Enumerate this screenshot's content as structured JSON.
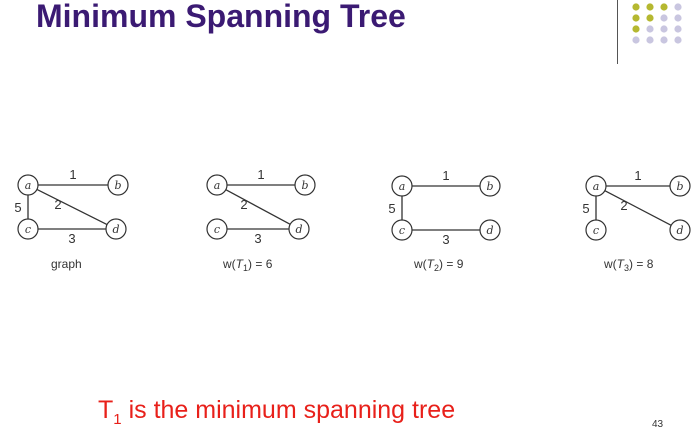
{
  "slide": {
    "title": "Minimum Spanning Tree",
    "caption_prefix": "T",
    "caption_sub": "1",
    "caption_rest": " is the minimum spanning tree",
    "page_number": "43"
  },
  "colors": {
    "title": "#3b1a73",
    "caption": "#e8201a",
    "dot_olive": "#b5b830",
    "dot_lavender": "#c9c6e0"
  },
  "graphs": [
    {
      "id": "graph",
      "label": "graph",
      "edges": [
        {
          "from": "a",
          "to": "b",
          "weight": "1"
        },
        {
          "from": "a",
          "to": "c",
          "weight": "5"
        },
        {
          "from": "a",
          "to": "d",
          "weight": "2"
        },
        {
          "from": "c",
          "to": "d",
          "weight": "3"
        }
      ]
    },
    {
      "id": "t1",
      "label_pre": "w(",
      "label_t": "T",
      "label_sub": "1",
      "label_post": ") = 6",
      "edges": [
        {
          "from": "a",
          "to": "b",
          "weight": "1"
        },
        {
          "from": "a",
          "to": "d",
          "weight": "2"
        },
        {
          "from": "c",
          "to": "d",
          "weight": "3"
        }
      ]
    },
    {
      "id": "t2",
      "label_pre": "w(",
      "label_t": "T",
      "label_sub": "2",
      "label_post": ") = 9",
      "edges": [
        {
          "from": "a",
          "to": "b",
          "weight": "1"
        },
        {
          "from": "a",
          "to": "c",
          "weight": "5"
        },
        {
          "from": "c",
          "to": "d",
          "weight": "3"
        }
      ]
    },
    {
      "id": "t3",
      "label_pre": "w(",
      "label_t": "T",
      "label_sub": "3",
      "label_post": ") = 8",
      "edges": [
        {
          "from": "a",
          "to": "b",
          "weight": "1"
        },
        {
          "from": "a",
          "to": "c",
          "weight": "5"
        },
        {
          "from": "a",
          "to": "d",
          "weight": "2"
        }
      ]
    }
  ]
}
